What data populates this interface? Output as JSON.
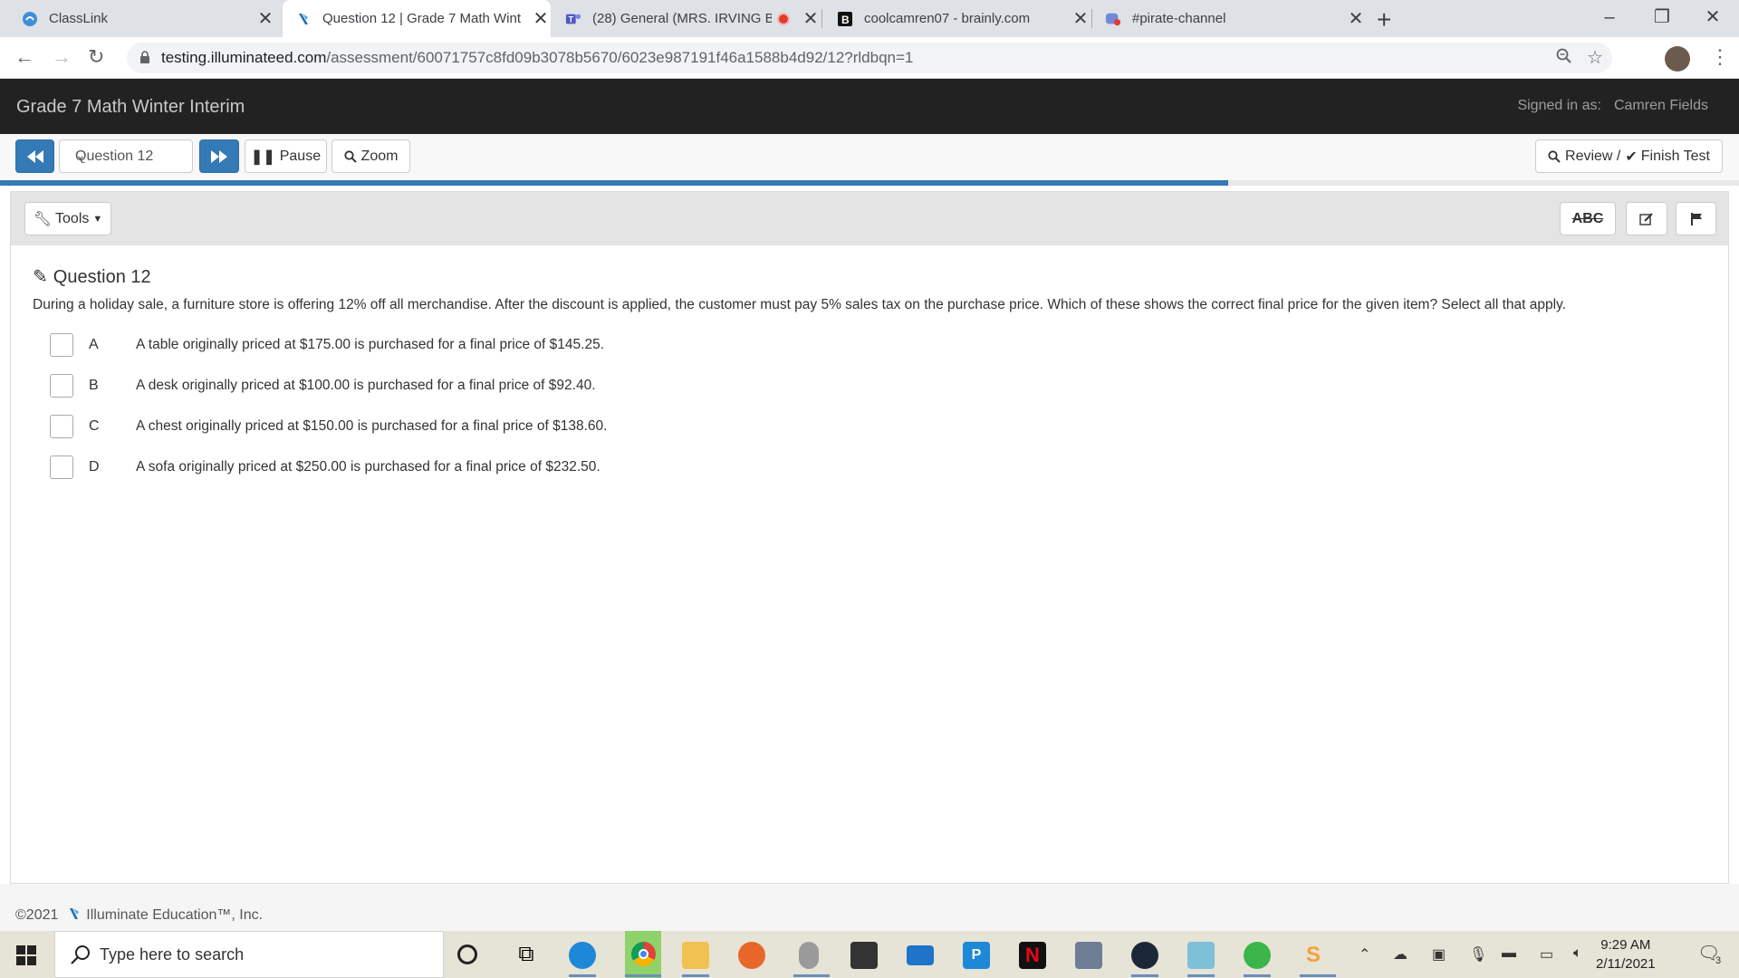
{
  "browser": {
    "tabs": [
      {
        "title": "ClassLink",
        "icon": "classlink-icon"
      },
      {
        "title": "Question 12 | Grade 7 Math Wint",
        "icon": "illuminate-icon"
      },
      {
        "title": "(28) General (MRS. IRVING B",
        "icon": "teams-icon"
      },
      {
        "title": "coolcamren07 - brainly.com",
        "icon": "brainly-icon"
      },
      {
        "title": "#pirate-channel",
        "icon": "discord-icon"
      }
    ],
    "url_host": "testing.illuminateed.com",
    "url_path": "/assessment/60071757c8fd09b3078b5670/6023e987191f46a1588b4d92/12?rldbqn=1"
  },
  "header": {
    "title": "Grade 7 Math Winter Interim",
    "signed_in_label": "Signed in as:",
    "user_name": "Camren Fields"
  },
  "toolbar": {
    "question_select": "Question 12",
    "pause_label": "Pause",
    "zoom_label": "Zoom",
    "review_label": "Review /",
    "finish_label": "Finish Test",
    "progress_fraction": 0.706
  },
  "panel": {
    "tools_label": "Tools",
    "abc_label": "ABC"
  },
  "question": {
    "title": "Question 12",
    "stem": "During a holiday sale, a furniture store is offering 12% off all merchandise. After the discount is applied, the customer must pay 5% sales tax on the purchase price. Which of these shows the correct final price for the given item? Select all that apply.",
    "choices": [
      {
        "letter": "A",
        "text": "A table originally priced at $175.00 is purchased for a final price of $145.25."
      },
      {
        "letter": "B",
        "text": "A desk originally priced at $100.00 is purchased for a final price of $92.40."
      },
      {
        "letter": "C",
        "text": "A chest originally priced at $150.00 is purchased for a final price of $138.60."
      },
      {
        "letter": "D",
        "text": "A sofa originally priced at $250.00 is purchased for a final price of $232.50."
      }
    ]
  },
  "footer": {
    "year": "©2021",
    "company": "Illuminate Education™, Inc."
  },
  "taskbar": {
    "search_placeholder": "Type here to search",
    "time": "9:29 AM",
    "date": "2/11/2021",
    "notification_count": "3"
  },
  "colors": {
    "primary": "#337ab7",
    "header_bg": "#222222"
  }
}
